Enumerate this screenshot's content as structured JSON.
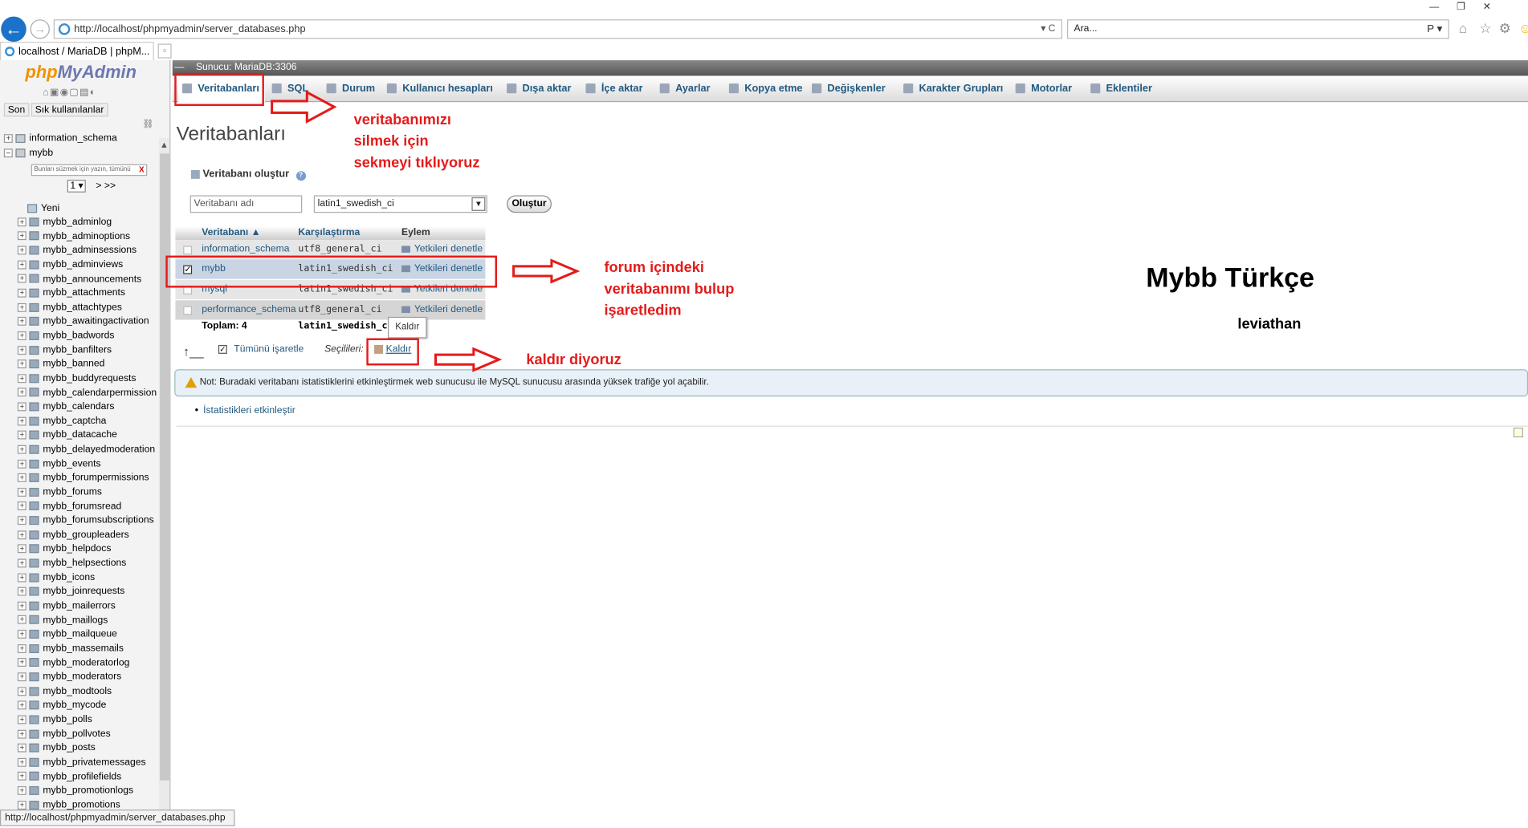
{
  "browser": {
    "url": "http://localhost/phpmyadmin/server_databases.php",
    "search_placeholder": "Ara...",
    "search_ctl": "P ▾",
    "addr_ctl": "▾ C",
    "tab_title": "localhost / MariaDB | phpM...",
    "status_url": "http://localhost/phpmyadmin/server_databases.php"
  },
  "left": {
    "logo_a": "php",
    "logo_b": "MyAdmin",
    "btn_recent": "Son",
    "btn_favorites": "Sık kullanılanlar",
    "db_information_schema": "information_schema",
    "db_mybb": "mybb",
    "filter_placeholder": "Bunları süzmek için yazın, tümünü",
    "filter_clear": "X",
    "pager_value": "1",
    "pager_next": "> >>",
    "new_item": "Yeni",
    "tables": [
      "mybb_adminlog",
      "mybb_adminoptions",
      "mybb_adminsessions",
      "mybb_adminviews",
      "mybb_announcements",
      "mybb_attachments",
      "mybb_attachtypes",
      "mybb_awaitingactivation",
      "mybb_badwords",
      "mybb_banfilters",
      "mybb_banned",
      "mybb_buddyrequests",
      "mybb_calendarpermission",
      "mybb_calendars",
      "mybb_captcha",
      "mybb_datacache",
      "mybb_delayedmoderation",
      "mybb_events",
      "mybb_forumpermissions",
      "mybb_forums",
      "mybb_forumsread",
      "mybb_forumsubscriptions",
      "mybb_groupleaders",
      "mybb_helpdocs",
      "mybb_helpsections",
      "mybb_icons",
      "mybb_joinrequests",
      "mybb_mailerrors",
      "mybb_maillogs",
      "mybb_mailqueue",
      "mybb_massemails",
      "mybb_moderatorlog",
      "mybb_moderators",
      "mybb_modtools",
      "mybb_mycode",
      "mybb_polls",
      "mybb_pollvotes",
      "mybb_posts",
      "mybb_privatemessages",
      "mybb_profilefields",
      "mybb_promotionlogs",
      "mybb_promotions"
    ]
  },
  "server_label": "Sunucu: MariaDB:3306",
  "tabs": [
    "Veritabanları",
    "SQL",
    "Durum",
    "Kullanıcı hesapları",
    "Dışa aktar",
    "İçe aktar",
    "Ayarlar",
    "Kopya etme",
    "Değişkenler",
    "Karakter Grupları",
    "Motorlar",
    "Eklentiler"
  ],
  "page": {
    "title": "Veritabanları",
    "create_label": "Veritabanı oluştur",
    "dbname_placeholder": "Veritabanı adı",
    "collation_value": "latin1_swedish_ci",
    "create_button": "Oluştur"
  },
  "table": {
    "headers": [
      "Veritabanı ▲",
      "Karşılaştırma",
      "Eylem"
    ],
    "rows": [
      {
        "name": "information_schema",
        "collation": "utf8_general_ci",
        "action": "Yetkileri denetle"
      },
      {
        "name": "mybb",
        "collation": "latin1_swedish_ci",
        "action": "Yetkileri denetle"
      },
      {
        "name": "mysql",
        "collation": "latin1_swedish_ci",
        "action": "Yetkileri denetle"
      },
      {
        "name": "performance_schema",
        "collation": "utf8_general_ci",
        "action": "Yetkileri denetle"
      }
    ],
    "total": "Toplam: 4",
    "total_collation": "latin1_swedish_c"
  },
  "controls": {
    "check_all": "Tümünü işaretle",
    "selected": "Seçilileri:",
    "drop": "Kaldır",
    "tooltip": "Kaldır"
  },
  "notice": "Not: Buradaki veritabanı istatistiklerini etkinleştirmek web sunucusu ile MySQL sunucusu arasında yüksek trafiğe yol açabilir.",
  "stats_link": "İstatistikleri etkinleştir",
  "annotations": {
    "note1": [
      "veritabanımızı",
      "silmek için",
      "sekmeyi tıklıyoruz"
    ],
    "note2": [
      "forum içindeki",
      "veritabanımı bulup",
      "işaretledim"
    ],
    "note3": "kaldır diyoruz",
    "title": "Mybb Türkçe",
    "subtitle": "leviathan"
  },
  "colors": {
    "annotation": "#e41b1b",
    "link": "#235a81"
  }
}
